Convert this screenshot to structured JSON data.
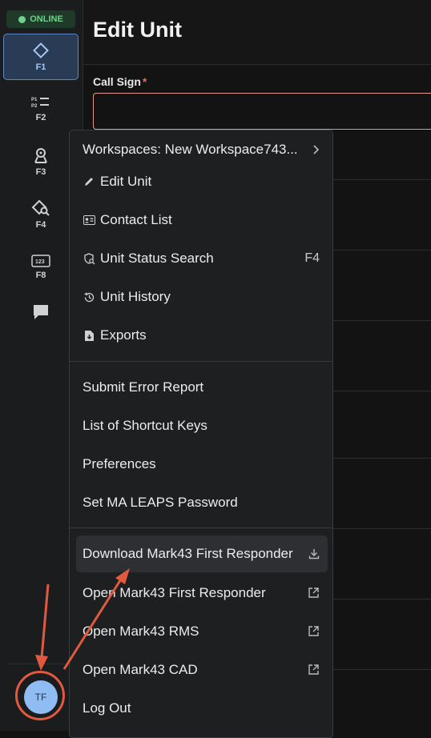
{
  "status": {
    "label": "ONLINE",
    "color": "#6fd08c"
  },
  "nav": [
    {
      "key": "F1",
      "icon": "diamond-icon",
      "active": true
    },
    {
      "key": "F2",
      "icon": "priority-list-icon",
      "active": false
    },
    {
      "key": "F3",
      "icon": "map-pin-icon",
      "active": false
    },
    {
      "key": "F4",
      "icon": "search-location-icon",
      "active": false
    },
    {
      "key": "F8",
      "icon": "number-pad-icon",
      "active": false
    },
    {
      "key": "",
      "icon": "chat-icon",
      "active": false
    }
  ],
  "user": {
    "initials": "TF"
  },
  "page": {
    "title": "Edit Unit",
    "call_sign_label": "Call Sign",
    "required_mark": "*",
    "call_sign_value": ""
  },
  "menu": {
    "workspace": "Workspaces: New Workspace743...",
    "edit_unit": "Edit Unit",
    "contact_list": "Contact List",
    "unit_status_search": "Unit Status Search",
    "unit_status_search_shortcut": "F4",
    "unit_history": "Unit History",
    "exports": "Exports",
    "submit_error_report": "Submit Error Report",
    "shortcut_keys": "List of Shortcut Keys",
    "preferences": "Preferences",
    "set_ma_leaps": "Set MA LEAPS Password",
    "download_fr": "Download Mark43 First Responder",
    "open_fr": "Open Mark43 First Responder",
    "open_rms": "Open Mark43 RMS",
    "open_cad": "Open Mark43 CAD",
    "log_out": "Log Out"
  },
  "colors": {
    "accent": "#5f86c4",
    "annotation": "#e05a3f",
    "required": "#e86a5a"
  }
}
